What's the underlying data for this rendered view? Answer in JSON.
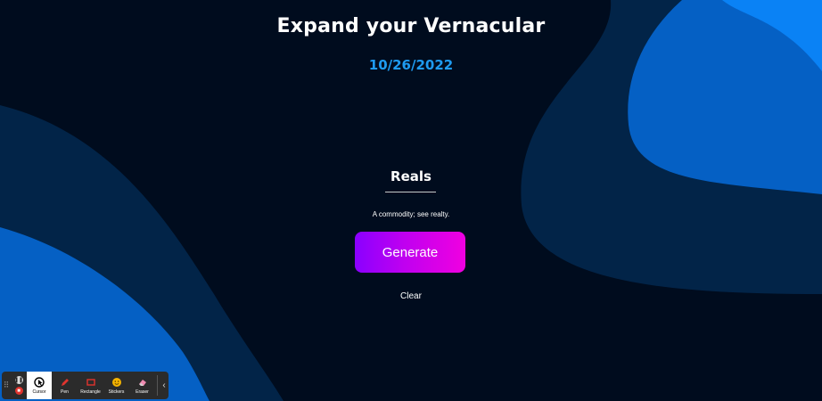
{
  "page": {
    "title": "Expand your Vernacular",
    "date": "10/26/2022",
    "word": "Reals",
    "definition": "A commodity; see realty.",
    "generate_label": "Generate",
    "clear_label": "Clear"
  },
  "toolbar": {
    "tools": [
      {
        "label": "Cursor",
        "icon": "cursor-icon",
        "active": true
      },
      {
        "label": "Pen",
        "icon": "pen-icon",
        "active": false
      },
      {
        "label": "Rectangle",
        "icon": "rectangle-icon",
        "active": false
      },
      {
        "label": "Stickers",
        "icon": "sticker-icon",
        "active": false
      },
      {
        "label": "Eraser",
        "icon": "eraser-icon",
        "active": false
      }
    ]
  },
  "colors": {
    "background": "#000c1e",
    "date": "#1e9bf0",
    "button_gradient_start": "#8a00ff",
    "button_gradient_end": "#f000e0"
  }
}
